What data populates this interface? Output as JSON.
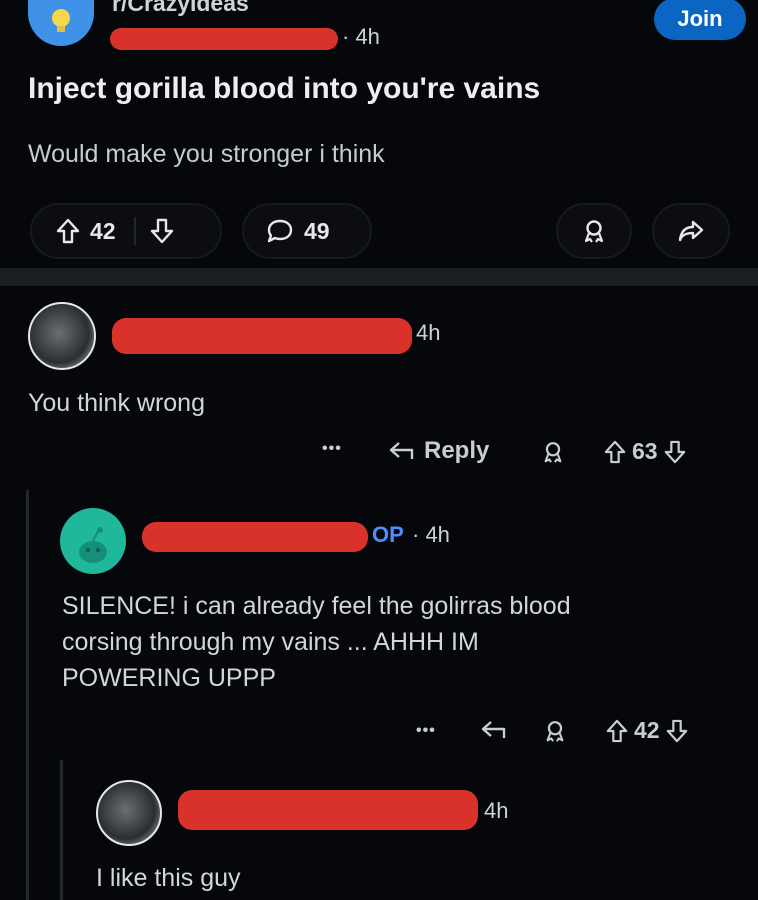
{
  "post": {
    "subreddit": "r/CrazyIdeas",
    "time": "· 4h",
    "join_label": "Join",
    "title": "Inject gorilla blood into you're vains",
    "body": "Would make you stronger i think",
    "upvotes": "42",
    "comments": "49"
  },
  "comments": [
    {
      "time": "4h",
      "text": "You think wrong",
      "reply_label": "Reply",
      "score": "63",
      "more": "•••"
    },
    {
      "op_tag": "OP",
      "time": "· 4h",
      "text_lines": [
        "SILENCE! i can already feel the golirras blood",
        "corsing through my vains ... AHHH IM",
        "POWERING UPPP"
      ],
      "score": "42",
      "more": "•••"
    },
    {
      "time": "4h",
      "text": "I like this guy"
    }
  ],
  "colors": {
    "background": "#05070a",
    "join": "#0a66c2",
    "redaction": "#d8322a",
    "op": "#4f8ff7"
  }
}
